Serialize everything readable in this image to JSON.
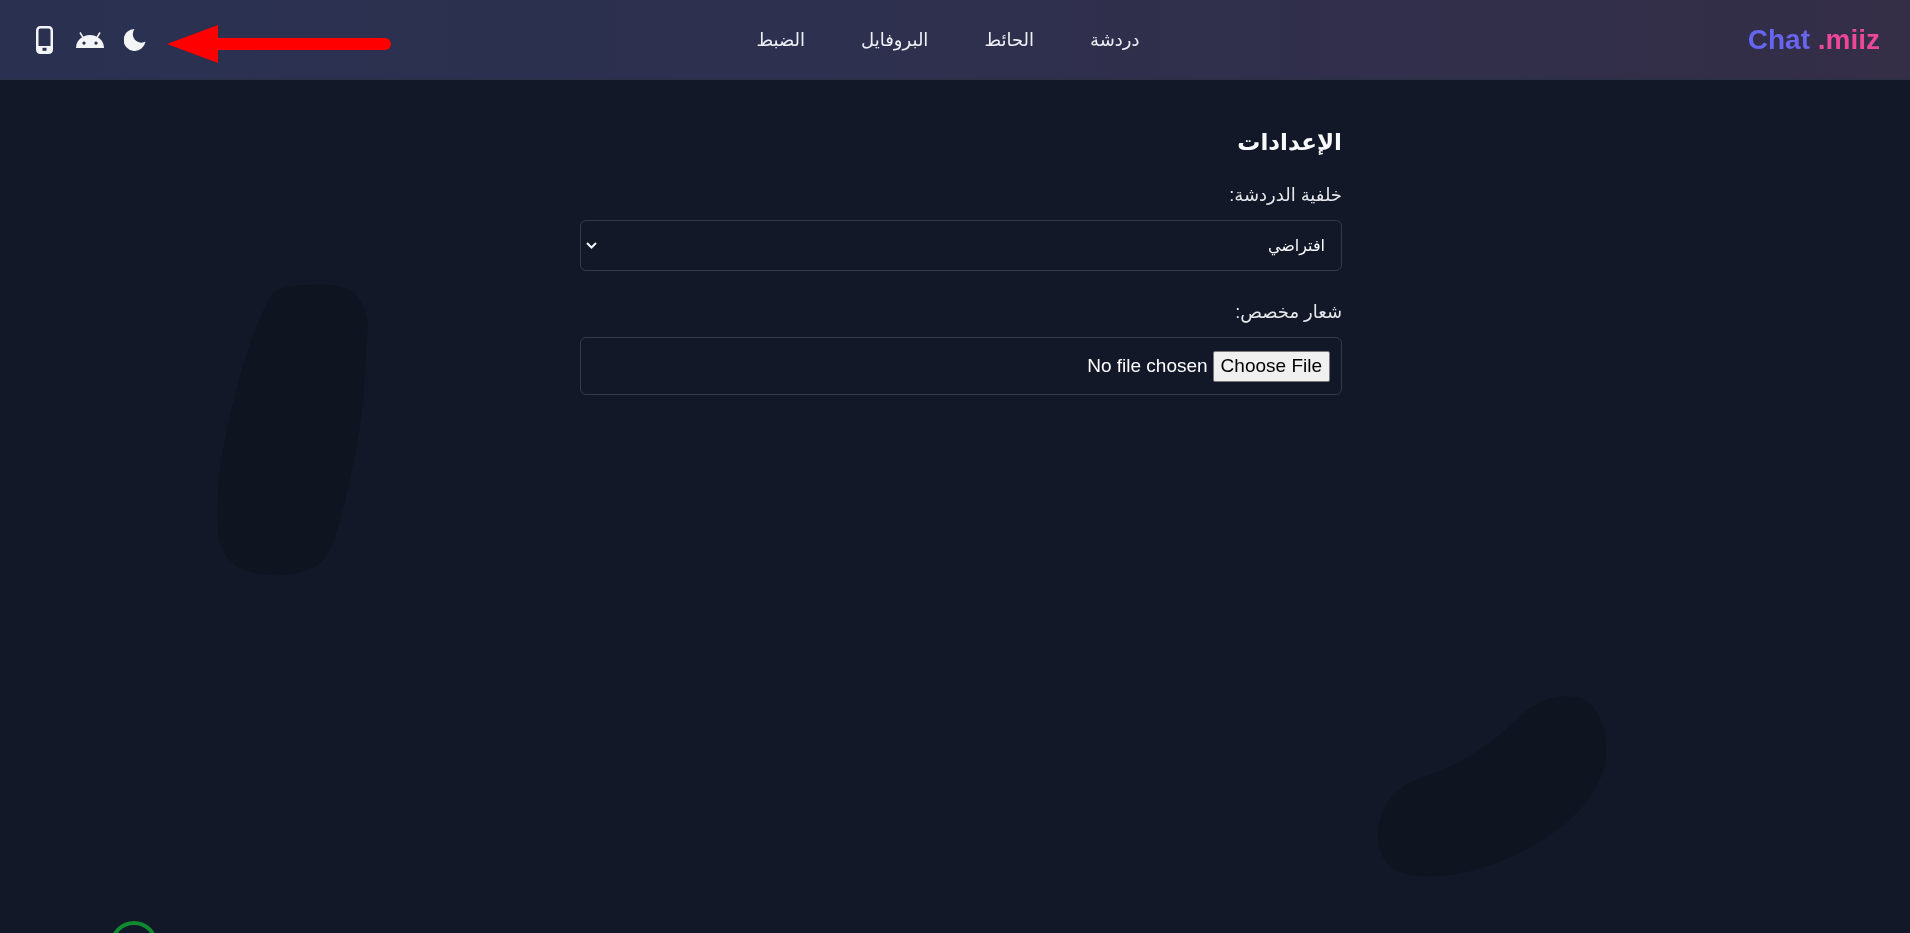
{
  "header": {
    "logo": "Chat .miiz",
    "nav": [
      {
        "label": "دردشة"
      },
      {
        "label": "الحائط"
      },
      {
        "label": "البروفايل"
      },
      {
        "label": "الضبط"
      }
    ]
  },
  "settings": {
    "title": "الإعدادات",
    "fields": [
      {
        "kind": "select",
        "label": "خلفية الدردشة:",
        "value": "افتراضي"
      },
      {
        "kind": "file",
        "label": "شعار مخصص:",
        "button": "Choose File",
        "status": "No file chosen"
      }
    ]
  }
}
